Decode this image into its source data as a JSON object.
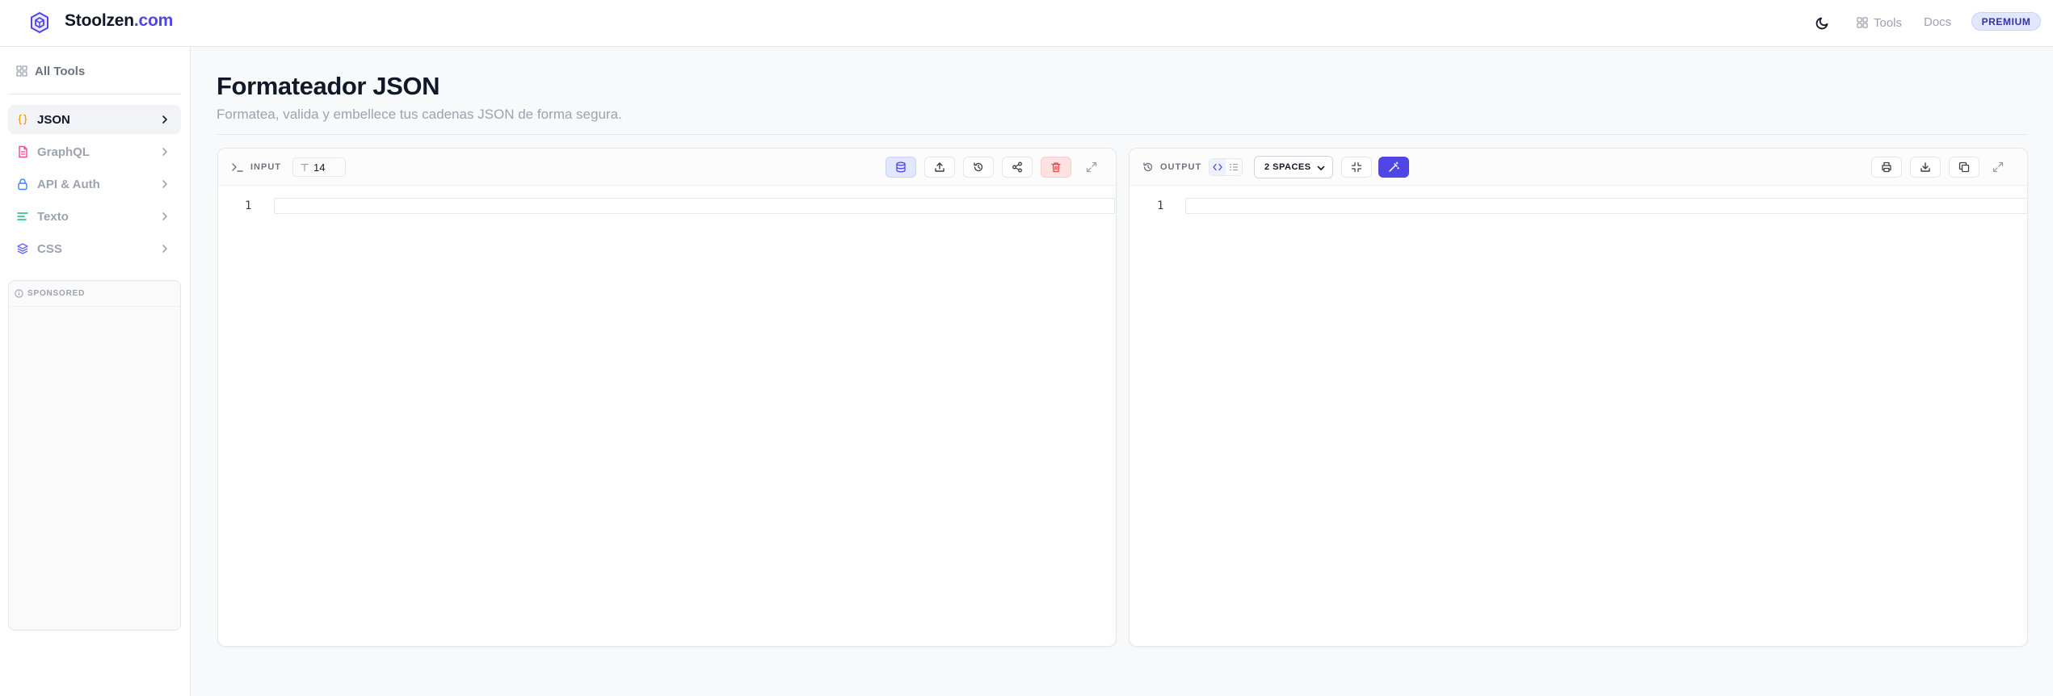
{
  "header": {
    "brand_name": "Stoolzen",
    "brand_tld": ".com",
    "nav_tools": "Tools",
    "nav_docs": "Docs",
    "premium_label": "PREMIUM"
  },
  "sidebar": {
    "all_tools": "All Tools",
    "items": [
      {
        "label": "JSON",
        "icon": "braces-icon",
        "color": "#f59e0b",
        "active": true
      },
      {
        "label": "GraphQL",
        "icon": "file-icon",
        "color": "#ec4899",
        "active": false
      },
      {
        "label": "API & Auth",
        "icon": "lock-icon",
        "color": "#3b82f6",
        "active": false
      },
      {
        "label": "Texto",
        "icon": "text-lines-icon",
        "color": "#10b981",
        "active": false
      },
      {
        "label": "CSS",
        "icon": "layers-icon",
        "color": "#6366f1",
        "active": false
      }
    ],
    "sponsored_label": "SPONSORED"
  },
  "main": {
    "title": "Formateador JSON",
    "subtitle": "Formatea, valida y embellece tus cadenas JSON de forma segura."
  },
  "input_panel": {
    "label": "INPUT",
    "font_size": "14",
    "line_number": "1",
    "toolbar": [
      "database-icon",
      "upload-icon",
      "history-icon",
      "share-icon",
      "trash-icon",
      "expand-icon"
    ]
  },
  "output_panel": {
    "label": "OUTPUT",
    "indent_option": "2 SPACES",
    "line_number": "1",
    "toolbar": [
      "print-icon",
      "download-icon",
      "copy-icon",
      "expand-icon"
    ]
  },
  "colors": {
    "accent": "#4f46e5",
    "danger": "#ef4444",
    "muted": "#9ca3af"
  }
}
